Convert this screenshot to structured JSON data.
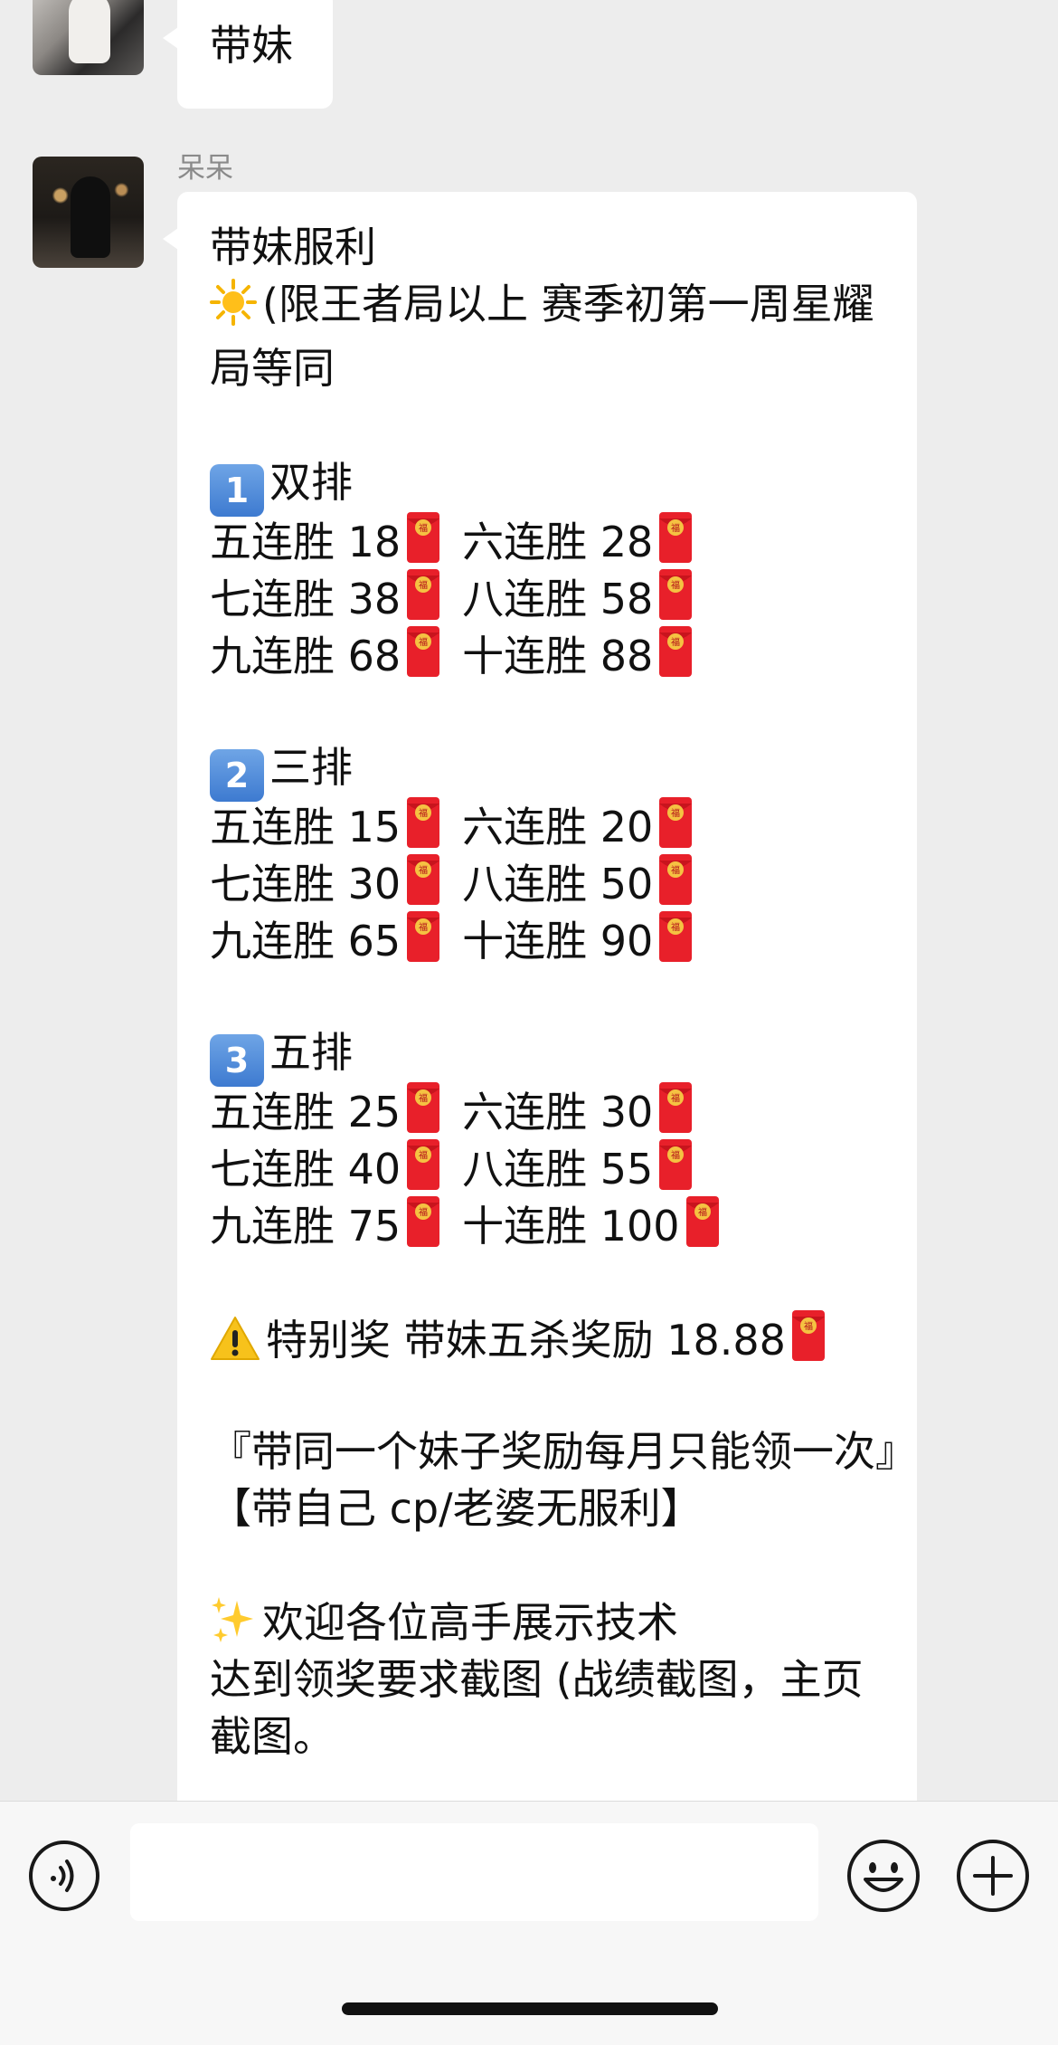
{
  "messages": [
    {
      "text": "带妹"
    },
    {
      "sender": "呆呆",
      "title": "带妹服利",
      "rule": "(限王者局以上 赛季初第一周星耀局等同",
      "sections": [
        {
          "num": "1",
          "label": "双排",
          "rows": [
            [
              "五连胜 18",
              "六连胜 28"
            ],
            [
              "七连胜 38",
              "八连胜 58"
            ],
            [
              "九连胜 68",
              "十连胜 88"
            ]
          ]
        },
        {
          "num": "2",
          "label": "三排",
          "rows": [
            [
              "五连胜 15",
              "六连胜 20"
            ],
            [
              "七连胜 30",
              "八连胜 50"
            ],
            [
              "九连胜 65",
              "十连胜 90"
            ]
          ]
        },
        {
          "num": "3",
          "label": "五排",
          "rows": [
            [
              "五连胜 25",
              "六连胜 30"
            ],
            [
              "七连胜 40",
              "八连胜 55"
            ],
            [
              "九连胜 75",
              "十连胜 100"
            ]
          ]
        }
      ],
      "special": "特别奖 带妹五杀奖励 18.88",
      "note1": "『带同一个妹子奖励每月只能领一次』",
      "note2": "【带自己 cp/老婆无服利】",
      "welcome": "欢迎各位高手展示技术",
      "req": "达到领奖要求截图 (战绩截图，主页截图。"
    }
  ],
  "icons": {
    "sun": "sun-emoji",
    "warning": "warning-emoji",
    "sparkles": "sparkles-emoji",
    "red_envelope": "red-envelope-emoji",
    "voice": "voice-icon",
    "emoji": "emoji-icon",
    "plus": "plus-icon"
  }
}
